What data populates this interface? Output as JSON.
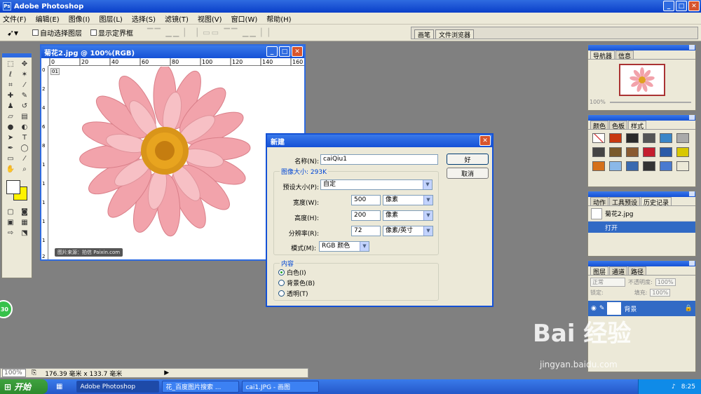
{
  "app": {
    "title": "Adobe Photoshop"
  },
  "menu": [
    "文件(F)",
    "编辑(E)",
    "图像(I)",
    "图层(L)",
    "选择(S)",
    "滤镜(T)",
    "视图(V)",
    "窗口(W)",
    "帮助(H)"
  ],
  "options": {
    "auto_select": "自动选择图层",
    "show_bounds": "显示定界框",
    "well_tabs": [
      "画笔",
      "文件浏览器"
    ]
  },
  "document": {
    "title": "菊花2.jpg @ 100%(RGB)",
    "ruler_h": [
      "0",
      "20",
      "40",
      "60",
      "80",
      "100",
      "120",
      "140",
      "160"
    ],
    "ruler_v": [
      "0",
      "2",
      "4",
      "6",
      "8",
      "1",
      "1",
      "1",
      "1",
      "1",
      "2"
    ],
    "watermark": "图片来源：拍信 Paixin.com",
    "corner_badge": "01"
  },
  "dialog": {
    "title": "新建",
    "name_label": "名称(N):",
    "name_value": "caiQiu1",
    "ok": "好",
    "cancel": "取消",
    "image_size": "图像大小: 293K",
    "preset_label": "预设大小(P):",
    "preset_value": "自定",
    "width_label": "宽度(W):",
    "width_value": "500",
    "width_unit": "像素",
    "height_label": "高度(H):",
    "height_value": "200",
    "height_unit": "像素",
    "res_label": "分辨率(R):",
    "res_value": "72",
    "res_unit": "像素/英寸",
    "mode_label": "模式(M):",
    "mode_value": "RGB 颜色",
    "contents_label": "内容",
    "contents": [
      "白色(I)",
      "背景色(B)",
      "透明(T)"
    ],
    "contents_selected": 0
  },
  "panels": {
    "navigator_tabs": [
      "导航器",
      "信息"
    ],
    "navigator_zoom": "100%",
    "color_tabs": [
      "颜色",
      "色板",
      "样式"
    ],
    "history_tabs": [
      "动作",
      "工具预设",
      "历史记录"
    ],
    "history_items": [
      "菊花2.jpg",
      "打开"
    ],
    "layers_tabs": [
      "图层",
      "通道",
      "路径"
    ],
    "layers_mode": "正常",
    "layers_opacity_label": "不透明度:",
    "layers_opacity": "100%",
    "layers_lock": "锁定:",
    "layers_fill_label": "填充:",
    "layers_fill": "100%",
    "layer_name": "背景"
  },
  "status": {
    "zoom": "100%",
    "doc_size": "176.39 毫米 x 133.7 毫米"
  },
  "taskbar": {
    "start": "开始",
    "tasks": [
      "Adobe Photoshop",
      "花_百度图片搜索 ...",
      "cai1.JPG - 画图"
    ],
    "time": "8:25"
  },
  "overlay": {
    "badge": "30",
    "brand": "Bai 经验",
    "url": "jingyan.baidu.com"
  },
  "colors": {
    "title_blue": "#1451d6",
    "chrome": "#ece9d8",
    "foreground": "#ffffff",
    "background": "#fff200",
    "workspace": "#808080"
  }
}
